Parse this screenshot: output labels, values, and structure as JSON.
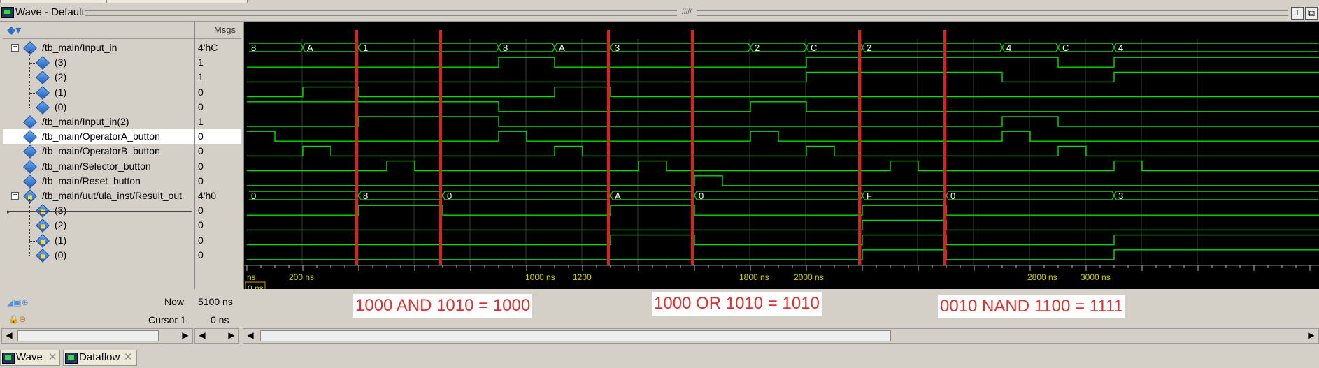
{
  "window": {
    "title": "Wave - Default",
    "grip": "/////",
    "btn_plus": "+",
    "btn_restore": "⧉"
  },
  "names_pane": {
    "header_icon": "signal-icon"
  },
  "msgs_header": "Msgs",
  "signals": [
    {
      "name": "/tb_main/Input_in",
      "value": "4'hC",
      "expandable": true,
      "level": 0,
      "kind": "in"
    },
    {
      "name": "(3)",
      "value": "1",
      "level": 1,
      "kind": "in"
    },
    {
      "name": "(2)",
      "value": "1",
      "level": 1,
      "kind": "in"
    },
    {
      "name": "(1)",
      "value": "0",
      "level": 1,
      "kind": "in"
    },
    {
      "name": "(0)",
      "value": "0",
      "level": 1,
      "kind": "in"
    },
    {
      "name": "/tb_main/Input_in(2)",
      "value": "1",
      "level": 0,
      "kind": "in"
    },
    {
      "name": "/tb_main/OperatorA_button",
      "value": "0",
      "level": 0,
      "kind": "in",
      "selected": true
    },
    {
      "name": "/tb_main/OperatorB_button",
      "value": "0",
      "level": 0,
      "kind": "in"
    },
    {
      "name": "/tb_main/Selector_button",
      "value": "0",
      "level": 0,
      "kind": "in"
    },
    {
      "name": "/tb_main/Reset_button",
      "value": "0",
      "level": 0,
      "kind": "in"
    },
    {
      "name": "/tb_main/uut/ula_inst/Result_out",
      "value": "4'h0",
      "expandable": true,
      "level": 0,
      "kind": "out"
    },
    {
      "name": "(3)",
      "value": "0",
      "level": 1,
      "kind": "out"
    },
    {
      "name": "(2)",
      "value": "0",
      "level": 1,
      "kind": "out"
    },
    {
      "name": "(1)",
      "value": "0",
      "level": 1,
      "kind": "out"
    },
    {
      "name": "(0)",
      "value": "0",
      "level": 1,
      "kind": "out"
    }
  ],
  "status": {
    "now_label": "Now",
    "now_value": "5100 ns",
    "cursor_label": "Cursor 1",
    "cursor_value": "0 ns",
    "cursor_box": "0 ns"
  },
  "timeline": {
    "ticks": [
      "ns",
      "200 ns",
      "1000 ns",
      "1200",
      "1800 ns",
      "2000 ns",
      "2800 ns",
      "3000 ns"
    ]
  },
  "annotations": [
    "1000 AND 1010 = 1000",
    "1000 OR 1010 = 1010",
    "0010 NAND 1100 = 1111"
  ],
  "bus_labels": {
    "input_in": [
      "8",
      "A",
      "1",
      "8",
      "A",
      "3",
      "2",
      "C",
      "2",
      "4",
      "C",
      "4"
    ],
    "result_out": [
      "0",
      "8",
      "0",
      "A",
      "0",
      "F",
      "0",
      "3"
    ]
  },
  "tabs": [
    {
      "label": "Wave"
    },
    {
      "label": "Dataflow"
    }
  ],
  "colors": {
    "wave": "#00e000",
    "marker": "#e02020",
    "bg": "#000000",
    "grid": "#3a3a3a"
  }
}
